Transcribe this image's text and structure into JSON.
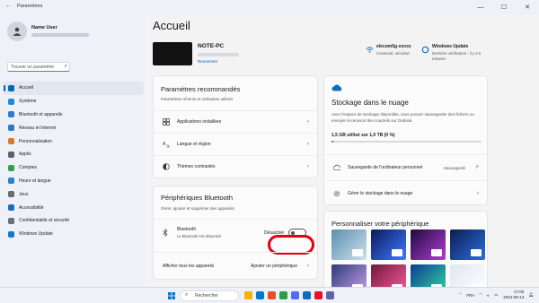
{
  "window": {
    "title": "Paramètres",
    "back": "←",
    "minimize": "—",
    "maximize": "☐",
    "close": "✕"
  },
  "user": {
    "name": "Name User"
  },
  "search": {
    "placeholder": "Trouver un paramètre",
    "icon": "search-icon"
  },
  "nav": [
    {
      "label": "Accueil",
      "color": "#0067c0",
      "active": true
    },
    {
      "label": "Système",
      "color": "#1c8bd6"
    },
    {
      "label": "Bluetooth et appareils",
      "color": "#2b7cd3"
    },
    {
      "label": "Réseau et Internet",
      "color": "#3277c5"
    },
    {
      "label": "Personnalisation",
      "color": "#d97a2b"
    },
    {
      "label": "Applis",
      "color": "#5a6271"
    },
    {
      "label": "Comptes",
      "color": "#30a04d"
    },
    {
      "label": "Heure et langue",
      "color": "#2a7fd0"
    },
    {
      "label": "Jeux",
      "color": "#6b6b6b"
    },
    {
      "label": "Accessibilité",
      "color": "#1a6fc2"
    },
    {
      "label": "Confidentialité et sécurité",
      "color": "#6b6f78"
    },
    {
      "label": "Windows Update",
      "color": "#0f78d4"
    }
  ],
  "main": {
    "title": "Accueil",
    "device": {
      "name": "NOTE-PC",
      "rename": "Renommer"
    },
    "wifi": {
      "title": "elecom5g-xxxxx",
      "status": "Connecté, sécurisé"
    },
    "update": {
      "title": "Windows Update",
      "line1": "Dernière vérification : il y a 5",
      "line2": "minutes"
    }
  },
  "recommended": {
    "title": "Paramètres recommandés",
    "subtitle": "Paramètres récents et ordinaires utilisés",
    "items": [
      {
        "label": "Applications installées"
      },
      {
        "label": "Langue et région"
      },
      {
        "label": "Thèmes contrastés"
      }
    ],
    "chevron": "›"
  },
  "bluetooth": {
    "title": "Périphériques Bluetooth",
    "subtitle": "Gérer, ajouter et supprimer des appareils.",
    "name": "Bluetooth",
    "status": "Le Bluetooth est désactivé",
    "toggle_label": "Désactivé",
    "toggle_on": false,
    "view_all": "Afficher tous les appareils",
    "add_device": "Ajouter un périphérique",
    "chevron": "›"
  },
  "cloud": {
    "title": "Stockage dans le nuage",
    "description": "Avec l'espace de stockage disponible, vous pouvez sauvegarder des fichiers ou envoyer et recevoir des courriels sur Outlook.",
    "usage": "1,5 GB utilisé sur 1,0 TB (0 %)",
    "usage_fraction": 0.01,
    "backup_label": "Sauvegarde de l'ordinateur personnel",
    "backup_status": "Sauvegardé",
    "manage_label": "Gérer le stockage dans le nuage",
    "chevron": "›",
    "external": "↗"
  },
  "personalize": {
    "title": "Personnaliser votre périphérique",
    "thumbs": [
      {
        "colors": [
          "#5b8fb0",
          "#cfe0ea"
        ]
      },
      {
        "colors": [
          "#0a1a5c",
          "#3d7bff"
        ]
      },
      {
        "colors": [
          "#1b0c3c",
          "#b43bd6"
        ]
      },
      {
        "colors": [
          "#0c1f4d",
          "#2c6be0"
        ]
      },
      {
        "colors": [
          "#2d3a7a",
          "#c6a3e8"
        ]
      },
      {
        "colors": [
          "#701a3a",
          "#ff5aa0"
        ]
      },
      {
        "colors": [
          "#0b3d8c",
          "#33d6a6"
        ]
      },
      {
        "colors": [
          "#dfe7f2",
          "#ffffff"
        ]
      }
    ]
  },
  "taskbar": {
    "search": "Rechercher",
    "apps": [
      "#f2b400",
      "#0078d4",
      "#e94e2b",
      "#2a9d48",
      "#4d6bfe",
      "#0f6cbd",
      "#e81123",
      "#6264a7"
    ],
    "lang": "FRA",
    "time": "17:00",
    "date": "2024-09-13"
  }
}
